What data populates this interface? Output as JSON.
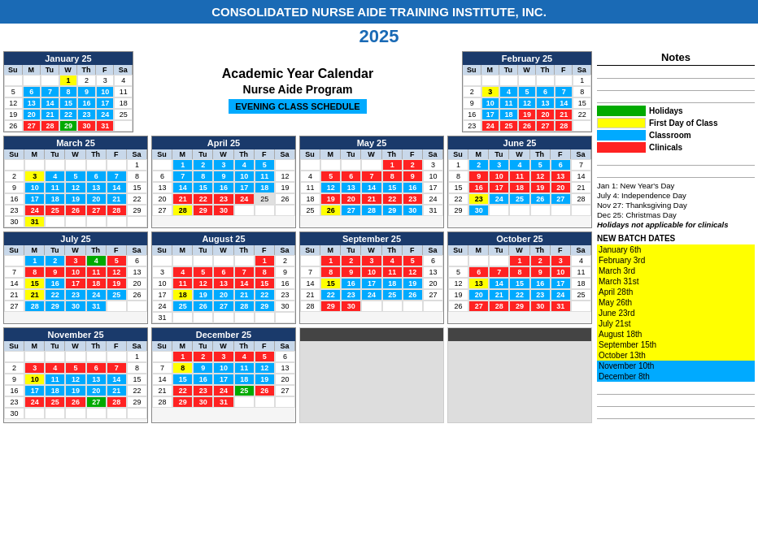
{
  "header": {
    "title": "CONSOLIDATED NURSE AIDE TRAINING INSTITUTE, INC.",
    "year": "2025",
    "subtitle1": "Academic Year Calendar",
    "subtitle2": "Nurse Aide Program",
    "evening": "EVENING CLASS SCHEDULE"
  },
  "notes": {
    "title": "Notes",
    "legend": [
      {
        "label": "Holidays",
        "color": "#00aa00"
      },
      {
        "label": "First Day of Class",
        "color": "#ffff00"
      },
      {
        "label": "Classroom",
        "color": "#00aaff"
      },
      {
        "label": "Clinicals",
        "color": "#ff2222"
      }
    ],
    "holidays": [
      "Jan 1: New Year's Day",
      "July 4: Independence Day",
      "Nov 27: Thanksgiving Day",
      "Dec 25: Christmas Day",
      "Holidays not applicable for clinicals"
    ],
    "batch_title": "NEW BATCH DATES",
    "batches": [
      {
        "label": "January 6th",
        "color": "yellow"
      },
      {
        "label": "February 3rd",
        "color": "yellow"
      },
      {
        "label": "March 3rd",
        "color": "yellow"
      },
      {
        "label": "March 31st",
        "color": "yellow"
      },
      {
        "label": "April 28th",
        "color": "yellow"
      },
      {
        "label": "May 26th",
        "color": "yellow"
      },
      {
        "label": "June 23rd",
        "color": "yellow"
      },
      {
        "label": "July 21st",
        "color": "yellow"
      },
      {
        "label": "August 18th",
        "color": "yellow"
      },
      {
        "label": "September 15th",
        "color": "yellow"
      },
      {
        "label": "October 13th",
        "color": "yellow"
      },
      {
        "label": "November 10th",
        "color": "blue"
      },
      {
        "label": "December 8th",
        "color": "blue"
      }
    ]
  }
}
